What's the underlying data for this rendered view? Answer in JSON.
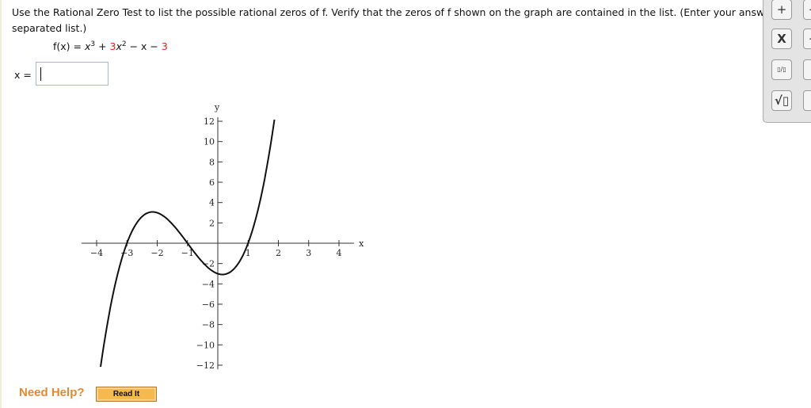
{
  "question": {
    "line1": "Use the Rational Zero Test to list the possible rational zeros of f. Verify that the zeros of f shown on the graph are contained in the list. (Enter your answer",
    "line2": "separated list.)"
  },
  "function": {
    "lhs": "f(x) =",
    "t1": "x",
    "e1": "3",
    "plus": " + ",
    "c2": "3",
    "t2": "x",
    "e2": "2",
    "rest": " − x − ",
    "c0": "3"
  },
  "answer": {
    "label": "x =",
    "value": ""
  },
  "palette": {
    "buttons": [
      "+",
      "−",
      "X",
      "÷",
      "▯/▯",
      "▯",
      "√▯",
      "▯"
    ]
  },
  "help": {
    "label": "Need Help?",
    "read_it": "Read It"
  },
  "chart_data": {
    "type": "line",
    "function": "x^3 + 3x^2 - x - 3",
    "x_domain": [
      -3.87,
      1.87
    ],
    "xlim": [
      -4.5,
      4.5
    ],
    "ylim": [
      -12,
      12
    ],
    "xlabel": "x",
    "ylabel": "y",
    "x_ticks": [
      -4,
      -3,
      -2,
      -1,
      1,
      2,
      3,
      4
    ],
    "y_ticks": [
      12,
      10,
      8,
      6,
      4,
      2,
      -2,
      -4,
      -6,
      -8,
      -10,
      -12
    ],
    "grid": false
  }
}
